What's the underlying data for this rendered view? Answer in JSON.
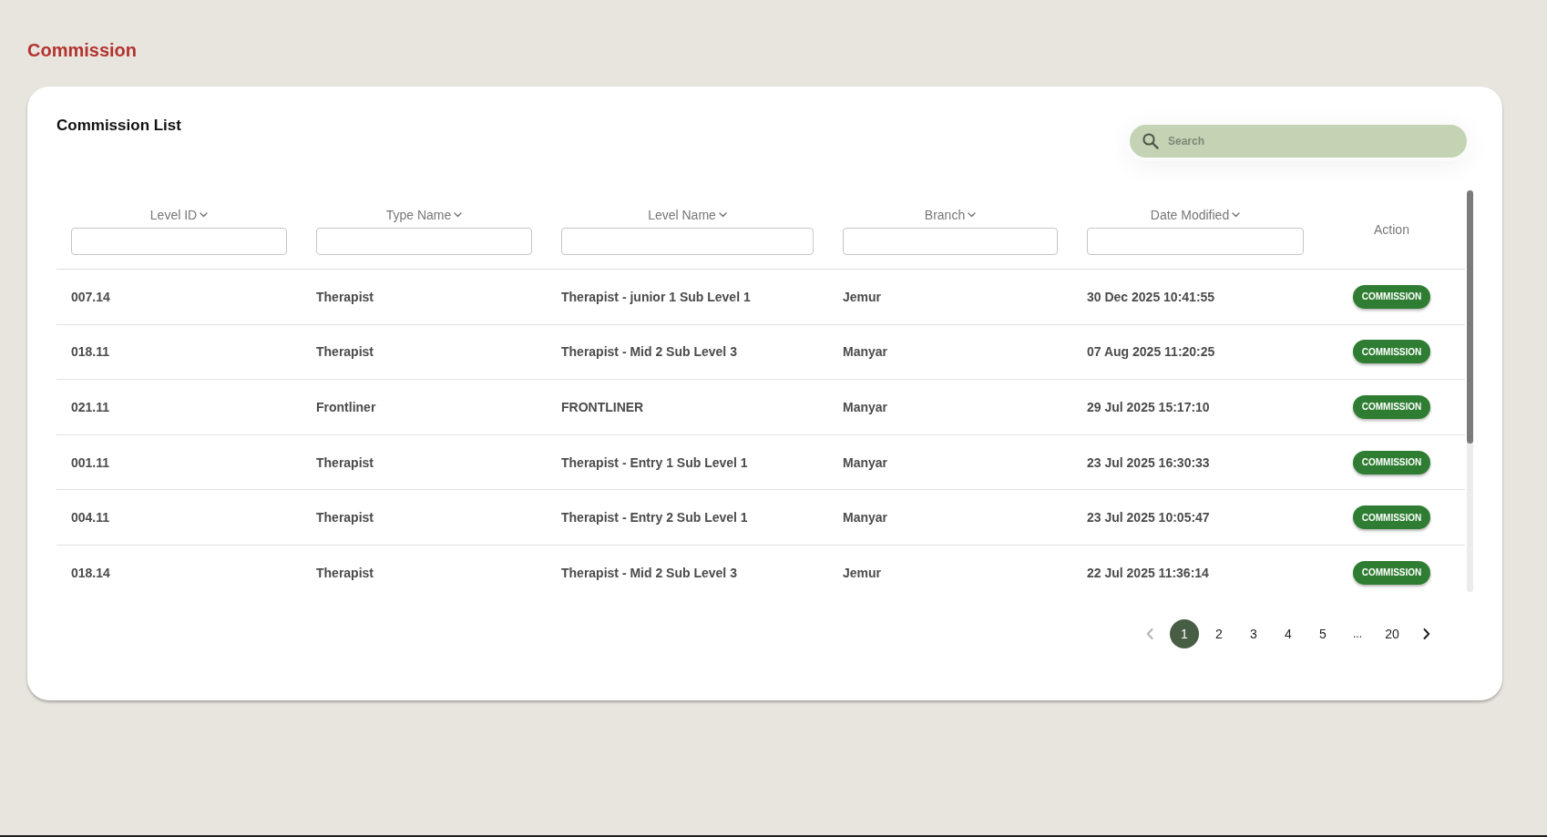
{
  "page_title": "Commission",
  "commission_list": {
    "title": "Commission List",
    "search": {
      "placeholder": "Search"
    },
    "table": {
      "columns": [
        {
          "label": "Level ID",
          "kind": "filter"
        },
        {
          "label": "Type Name",
          "kind": "filter"
        },
        {
          "label": "Level Name",
          "kind": "filter"
        },
        {
          "label": "Branch",
          "kind": "filter"
        },
        {
          "label": "Date Modified",
          "kind": "filter"
        },
        {
          "label": "Action",
          "kind": "plain"
        }
      ],
      "rows": [
        {
          "cells": [
            "007.14",
            "Therapist",
            "Therapist - junior 1 Sub Level 1",
            "Jemur",
            "30 Dec 2025 10:41:55"
          ],
          "action": "COMMISSION"
        },
        {
          "cells": [
            "018.11",
            "Therapist",
            "Therapist - Mid 2 Sub Level 3",
            "Manyar",
            "07 Aug 2025 11:20:25"
          ],
          "action": "COMMISSION"
        },
        {
          "cells": [
            "021.11",
            "Frontliner",
            "FRONTLINER",
            "Manyar",
            "29 Jul 2025 15:17:10"
          ],
          "action": "COMMISSION"
        },
        {
          "cells": [
            "001.11",
            "Therapist",
            "Therapist - Entry 1 Sub Level 1",
            "Manyar",
            "23 Jul 2025 16:30:33"
          ],
          "action": "COMMISSION"
        },
        {
          "cells": [
            "004.11",
            "Therapist",
            "Therapist - Entry 2 Sub Level 1",
            "Manyar",
            "23 Jul 2025 10:05:47"
          ],
          "action": "COMMISSION"
        },
        {
          "cells": [
            "018.14",
            "Therapist",
            "Therapist - Mid 2 Sub Level 3",
            "Jemur",
            "22 Jul 2025 11:36:14"
          ],
          "action": "COMMISSION"
        }
      ]
    },
    "pagination": {
      "previous": {
        "disabled": true
      },
      "pages": [
        {
          "label": "1",
          "kind": "page",
          "selected": true
        },
        {
          "label": "2",
          "kind": "page",
          "selected": false
        },
        {
          "label": "3",
          "kind": "page",
          "selected": false
        },
        {
          "label": "4",
          "kind": "page",
          "selected": false
        },
        {
          "label": "5",
          "kind": "page",
          "selected": false
        },
        {
          "label": "...",
          "kind": "ellipsis",
          "selected": false
        },
        {
          "label": "20",
          "kind": "page",
          "selected": false
        }
      ],
      "next": {
        "disabled": false
      }
    }
  }
}
